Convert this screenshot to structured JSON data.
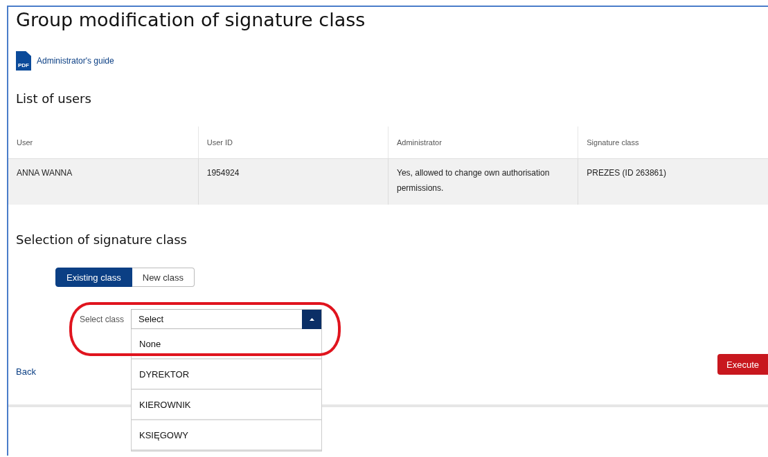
{
  "page": {
    "title": "Group modification of signature class",
    "guide": {
      "icon_text": "PDF",
      "label": "Administrator's guide"
    }
  },
  "users": {
    "heading": "List of users",
    "columns": [
      "User",
      "User ID",
      "Administrator",
      "Signature class"
    ],
    "rows": [
      [
        "ANNA WANNA",
        "1954924",
        "Yes, allowed to change own authorisation permissions.",
        "PREZES (ID 263861)"
      ]
    ]
  },
  "selection": {
    "heading": "Selection of signature class",
    "tabs": [
      {
        "label": "Existing class",
        "selected": true
      },
      {
        "label": "New class",
        "selected": false
      }
    ],
    "select": {
      "label": "Select class",
      "value": "Select",
      "expanded": true,
      "options": [
        "None",
        "DYREKTOR",
        "KIEROWNIK",
        "KSIĘGOWY"
      ]
    }
  },
  "annotation": {
    "highlight": true
  },
  "actions": {
    "back": "Back",
    "execute": "Execute"
  }
}
